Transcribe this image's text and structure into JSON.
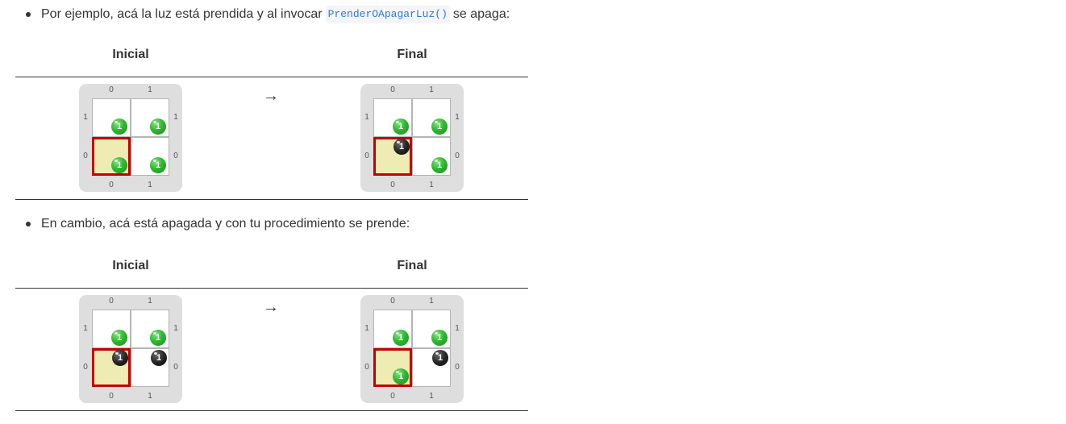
{
  "bullets": [
    {
      "before": "Por ejemplo, acá la luz está prendida y al invocar",
      "code": "PrenderOApagarLuz()",
      "after": "se apaga:"
    },
    {
      "text": "En cambio, acá está apagada y con tu procedimiento se prende:"
    }
  ],
  "headers": {
    "initial": "Inicial",
    "final": "Final"
  },
  "arrow": "→",
  "axis": {
    "col0": "0",
    "col1": "1",
    "row0": "0",
    "row1": "1"
  },
  "colors": {
    "green": "#2fb92f",
    "black": "#262626",
    "head": "#c40000",
    "head_fill": "#eeebb3"
  },
  "examples": [
    {
      "initial": {
        "head": {
          "col": 0,
          "row": 0
        },
        "cells": [
          {
            "col": 0,
            "row": 1,
            "ball": "green",
            "count": "1"
          },
          {
            "col": 1,
            "row": 1,
            "ball": "green",
            "count": "1"
          },
          {
            "col": 0,
            "row": 0,
            "ball": "green",
            "count": "1"
          },
          {
            "col": 1,
            "row": 0,
            "ball": "green",
            "count": "1"
          }
        ]
      },
      "final": {
        "head": {
          "col": 0,
          "row": 0
        },
        "cells": [
          {
            "col": 0,
            "row": 1,
            "ball": "green",
            "count": "1"
          },
          {
            "col": 1,
            "row": 1,
            "ball": "green",
            "count": "1"
          },
          {
            "col": 0,
            "row": 0,
            "ball": "black",
            "count": "1"
          },
          {
            "col": 1,
            "row": 0,
            "ball": "green",
            "count": "1"
          }
        ]
      }
    },
    {
      "initial": {
        "head": {
          "col": 0,
          "row": 0
        },
        "cells": [
          {
            "col": 0,
            "row": 1,
            "ball": "green",
            "count": "1"
          },
          {
            "col": 1,
            "row": 1,
            "ball": "green",
            "count": "1"
          },
          {
            "col": 0,
            "row": 0,
            "ball": "black",
            "count": "1"
          },
          {
            "col": 1,
            "row": 0,
            "ball": "black",
            "count": "1"
          }
        ]
      },
      "final": {
        "head": {
          "col": 0,
          "row": 0
        },
        "cells": [
          {
            "col": 0,
            "row": 1,
            "ball": "green",
            "count": "1"
          },
          {
            "col": 1,
            "row": 1,
            "ball": "green",
            "count": "1"
          },
          {
            "col": 0,
            "row": 0,
            "ball": "green",
            "count": "1"
          },
          {
            "col": 1,
            "row": 0,
            "ball": "black",
            "count": "1"
          }
        ]
      }
    }
  ]
}
